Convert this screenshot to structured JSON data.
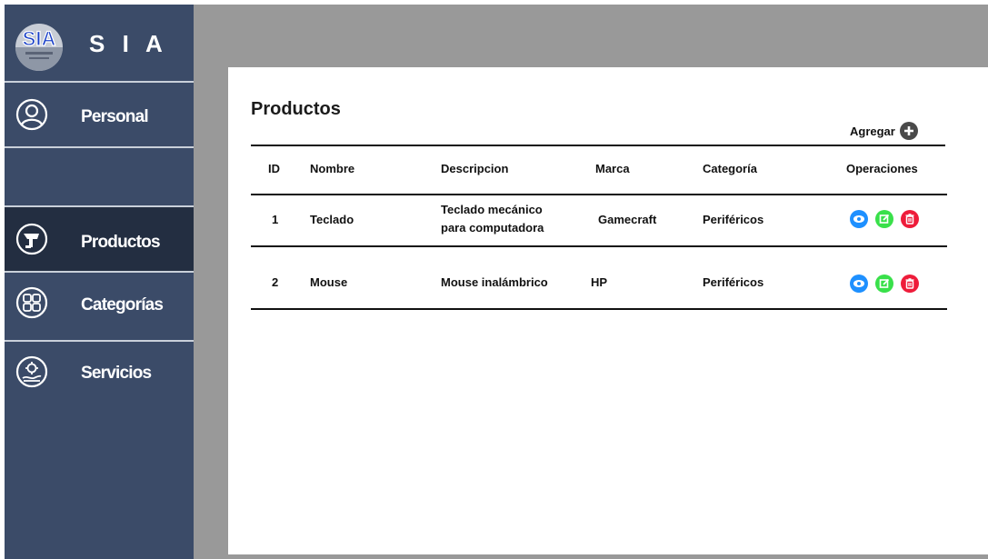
{
  "app": {
    "logo_text": "SIA",
    "title": "S I A"
  },
  "sidebar": {
    "items": [
      {
        "label": "Personal",
        "icon": "person-icon",
        "active": false
      },
      {
        "label": "Productos",
        "icon": "products-icon",
        "active": true
      },
      {
        "label": "Categorías",
        "icon": "categories-icon",
        "active": false
      },
      {
        "label": "Servicios",
        "icon": "services-icon",
        "active": false
      }
    ]
  },
  "main": {
    "title": "Productos",
    "add_label": "Agregar",
    "table": {
      "headers": [
        "ID",
        "Nombre",
        "Descripcion",
        "Marca",
        "Categoría",
        "Operaciones"
      ],
      "rows": [
        {
          "id": "1",
          "nombre": "Teclado",
          "descripcion": [
            "Teclado mecánico",
            "para computadora"
          ],
          "marca": "Gamecraft",
          "categoria": "Periféricos"
        },
        {
          "id": "2",
          "nombre": "Mouse",
          "descripcion": [
            "Mouse inalámbrico"
          ],
          "marca": "HP",
          "categoria": "Periféricos"
        }
      ],
      "operations": [
        {
          "icon": "view-icon",
          "color": "#1e90ff"
        },
        {
          "icon": "edit-icon",
          "color": "#39e04a"
        },
        {
          "icon": "delete-icon",
          "color": "#ee1c3a"
        }
      ]
    }
  },
  "colors": {
    "sidebar_bg": "#3b4b68",
    "sidebar_active": "#232e41",
    "frame_bg": "#999999"
  }
}
